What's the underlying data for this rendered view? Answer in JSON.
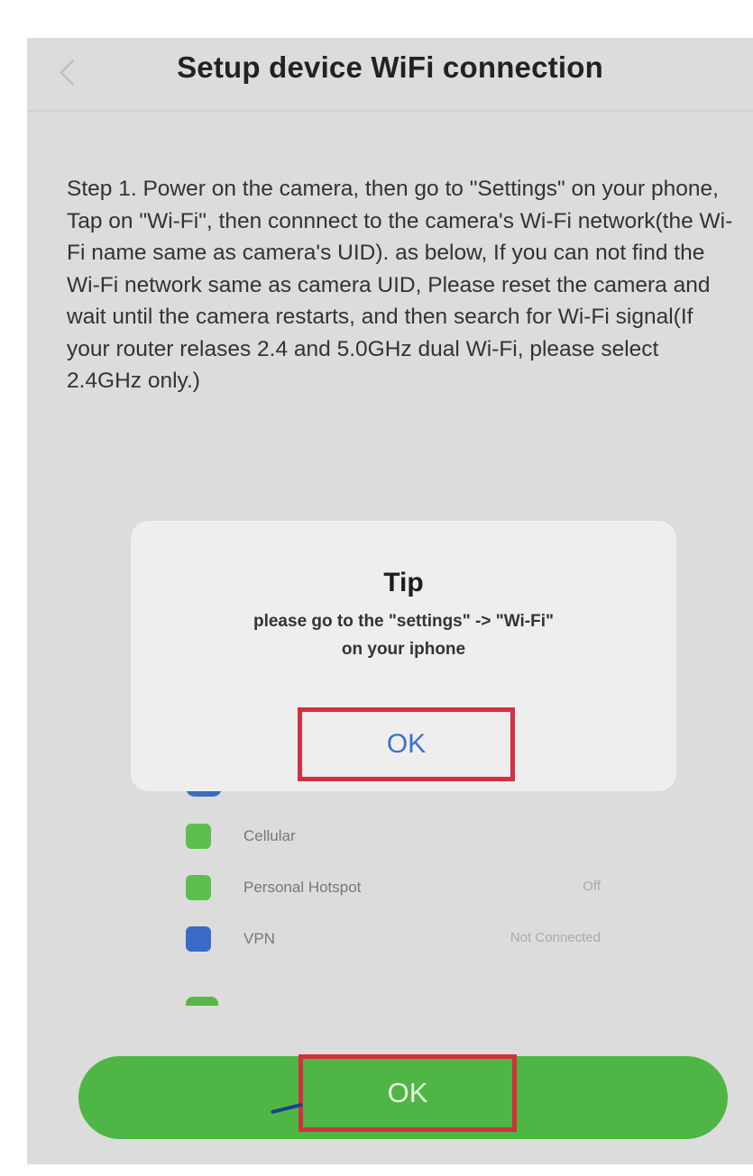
{
  "header": {
    "title": "Setup device WiFi connection"
  },
  "instructions": {
    "text": "Step 1. Power on the camera, then go to \"Settings\" on your phone, Tap on \"Wi-Fi\", then connnect to the camera's Wi-Fi network(the Wi-Fi name same as camera's UID). as below, If you can not find the Wi-Fi network same as camera UID, Please reset the camera and wait until the camera restarts, and then search for Wi-Fi signal(If your router relases 2.4 and 5.0GHz dual Wi-Fi, please select 2.4GHz only.)"
  },
  "tip_dialog": {
    "title": "Tip",
    "message_line1": "please go to the \"settings\" -> \"Wi-Fi\"",
    "message_line2": "on your iphone",
    "ok_label": "OK"
  },
  "settings_preview": {
    "rows": [
      {
        "label": "Cellular",
        "value": "",
        "icon_color": "#5cbf4e"
      },
      {
        "label": "Personal Hotspot",
        "value": "Off",
        "icon_color": "#5cbf4e"
      },
      {
        "label": "VPN",
        "value": "Not Connected",
        "icon_color": "#3a6bc9"
      }
    ]
  },
  "footer": {
    "confirm_label": "OK"
  },
  "colors": {
    "accent_green": "#4fb645",
    "highlight_red": "#d3303f",
    "link_blue": "#3a72c8"
  }
}
